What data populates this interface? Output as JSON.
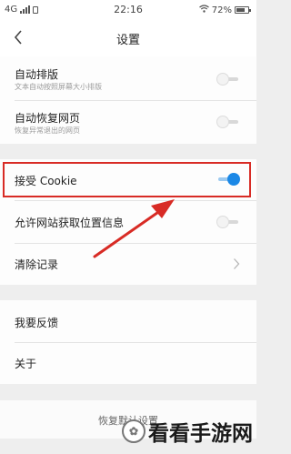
{
  "status_bar": {
    "network": "4G",
    "time": "22:16",
    "battery": "72%"
  },
  "nav": {
    "back_icon": "chevron-left-icon",
    "title": "设置"
  },
  "settings": {
    "auto_layout": {
      "label": "自动排版",
      "sub": "文本自动按照屏幕大小排版",
      "enabled": false
    },
    "auto_restore": {
      "label": "自动恢复网页",
      "sub": "恢复异常退出的网页",
      "enabled": false
    },
    "accept_cookie": {
      "label": "接受 Cookie",
      "enabled": true
    },
    "allow_location": {
      "label": "允许网站获取位置信息",
      "enabled": false
    },
    "clear_history": {
      "label": "清除记录"
    },
    "feedback": {
      "label": "我要反馈"
    },
    "about": {
      "label": "关于"
    },
    "reset": {
      "label": "恢复默认设置"
    }
  },
  "annotation": {
    "highlight_color": "#d82b25",
    "arrow_color": "#d82b25"
  },
  "watermark": {
    "text": "看看手游网",
    "icon": "watermark-logo-icon"
  },
  "colors": {
    "toggle_on": "#1b88e6",
    "background": "#eeeeee"
  }
}
